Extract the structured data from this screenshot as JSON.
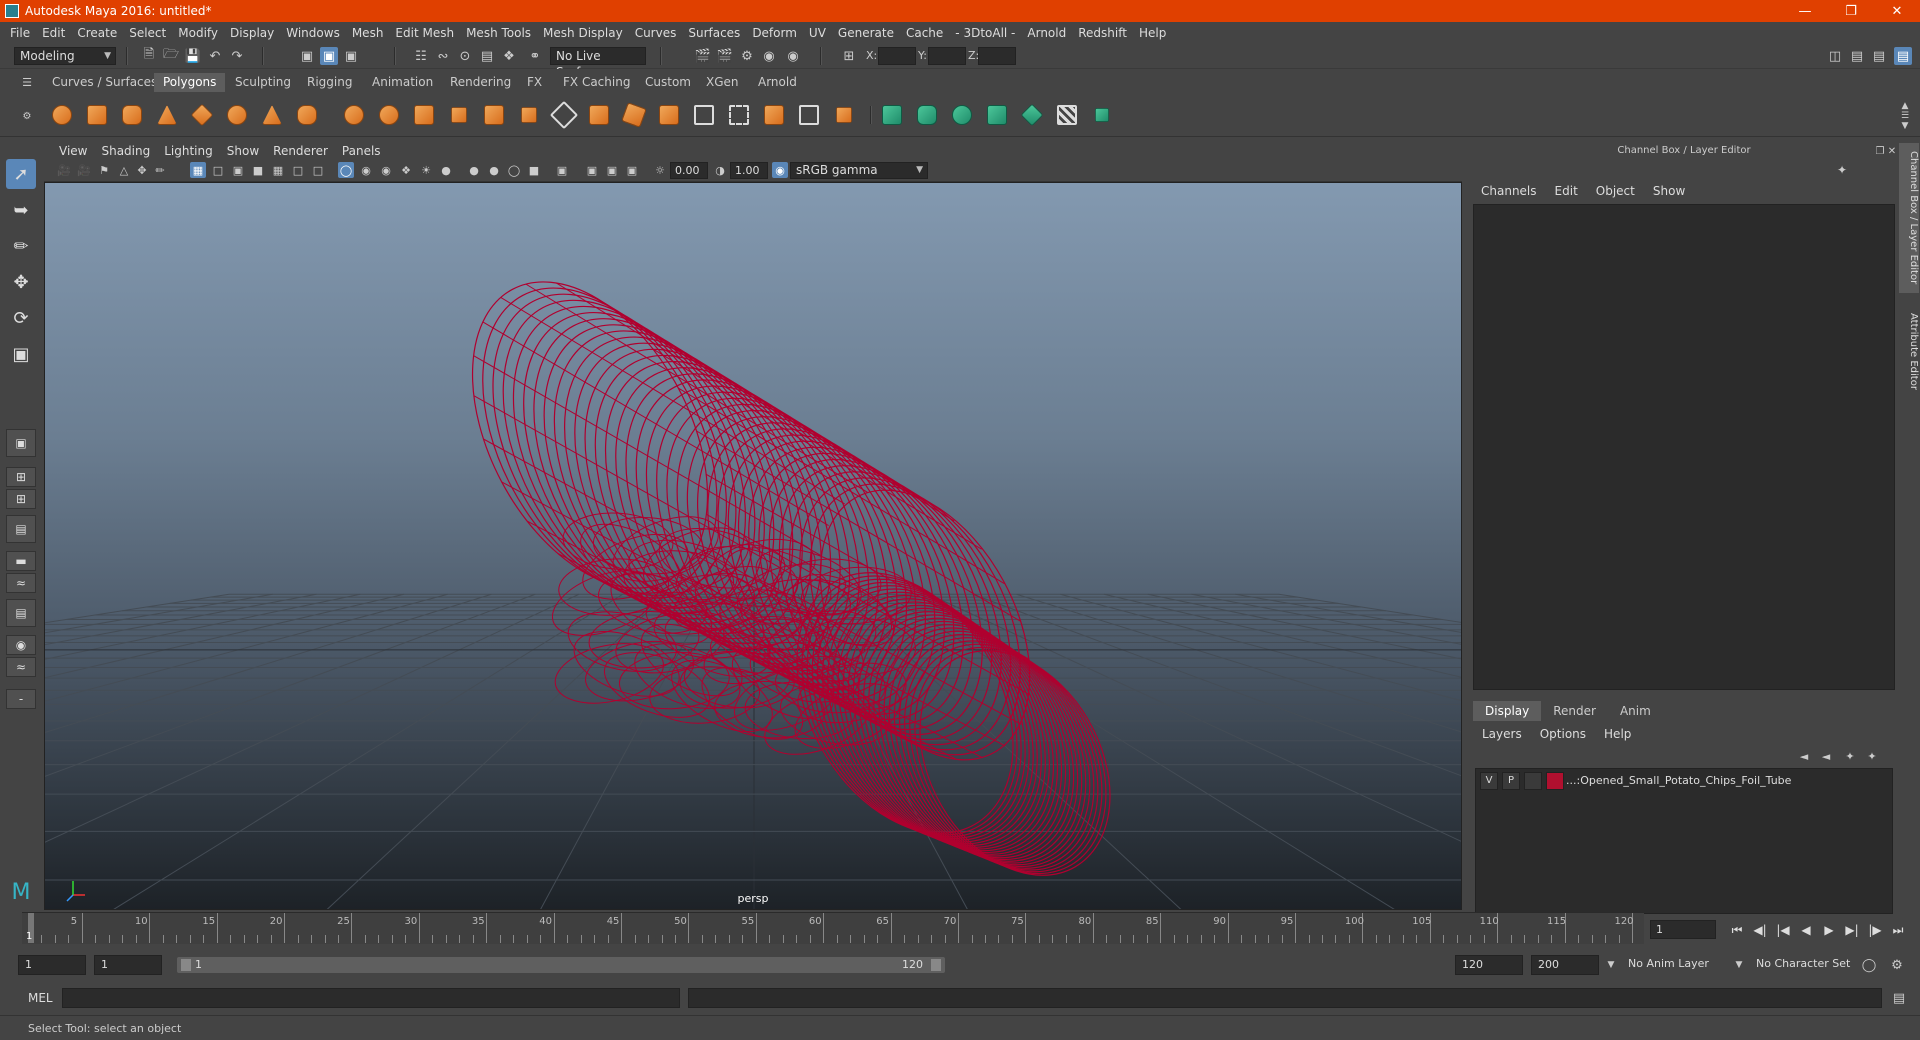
{
  "window": {
    "title": "Autodesk Maya 2016: untitled*"
  },
  "menu": [
    "File",
    "Edit",
    "Create",
    "Select",
    "Modify",
    "Display",
    "Windows",
    "Mesh",
    "Edit Mesh",
    "Mesh Tools",
    "Mesh Display",
    "Curves",
    "Surfaces",
    "Deform",
    "UV",
    "Generate",
    "Cache",
    "- 3DtoAll -",
    "Arnold",
    "Redshift",
    "Help"
  ],
  "status": {
    "mode": "Modeling",
    "live_surface": "No Live Surface",
    "x_label": "X:",
    "y_label": "Y:",
    "z_label": "Z:"
  },
  "shelf_tabs": [
    "Curves / Surfaces",
    "Polygons",
    "Sculpting",
    "Rigging",
    "Animation",
    "Rendering",
    "FX",
    "FX Caching",
    "Custom",
    "XGen",
    "Arnold"
  ],
  "shelf_active": "Polygons",
  "viewport": {
    "menu": [
      "View",
      "Shading",
      "Lighting",
      "Show",
      "Renderer",
      "Panels"
    ],
    "exposure": "0.00",
    "gamma": "1.00",
    "color_space": "sRGB gamma",
    "camera_label": "persp",
    "wire_color": "#b0002f"
  },
  "channel_box": {
    "header": "Channel Box / Layer Editor",
    "menu": [
      "Channels",
      "Edit",
      "Object",
      "Show"
    ],
    "layer_tabs": [
      "Display",
      "Render",
      "Anim"
    ],
    "layer_active": "Display",
    "layer_menu": [
      "Layers",
      "Options",
      "Help"
    ],
    "layer": {
      "v": "V",
      "p": "P",
      "color": "#b0102f",
      "name": "...:Opened_Small_Potato_Chips_Foil_Tube"
    }
  },
  "side_tabs": [
    "Channel Box / Layer Editor",
    "Attribute Editor"
  ],
  "timeline": {
    "ticks": [
      5,
      10,
      15,
      20,
      25,
      30,
      35,
      40,
      45,
      50,
      55,
      60,
      65,
      70,
      75,
      80,
      85,
      90,
      95,
      100,
      105,
      110,
      115,
      120
    ],
    "current_frame_label": "1",
    "current_frame_field": "1"
  },
  "range": {
    "start_field": "1",
    "playback_start": "1",
    "slider_start": "1",
    "slider_end": "120",
    "playback_end": "120",
    "end_field": "200",
    "anim_layer": "No Anim Layer",
    "character_set": "No Character Set"
  },
  "command": {
    "mel_label": "MEL"
  },
  "help_line": "Select Tool: select an object"
}
